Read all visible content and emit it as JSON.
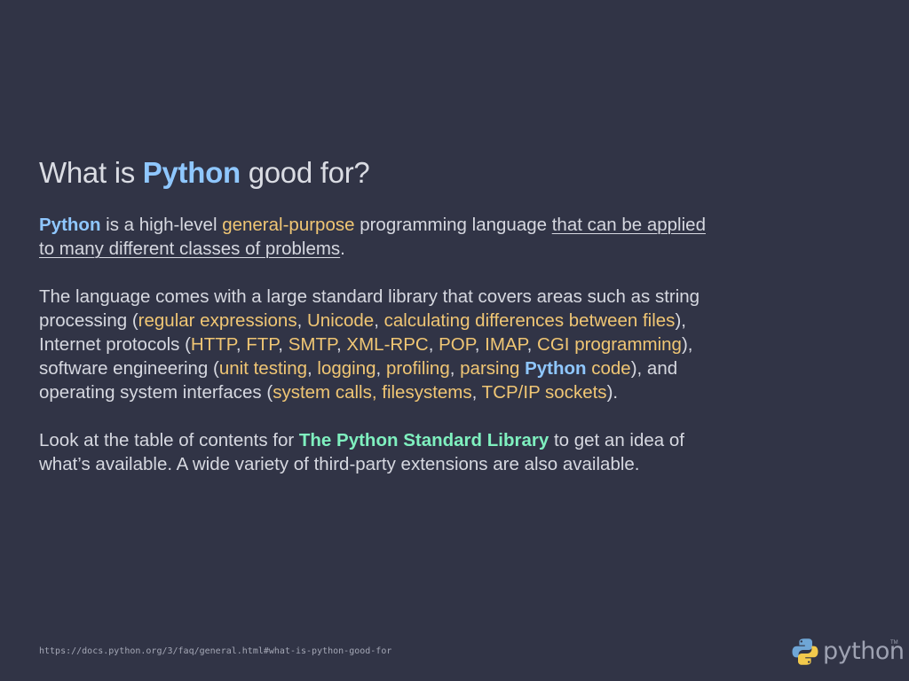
{
  "title": {
    "before": "What is ",
    "emph": "Python",
    "after": " good for?"
  },
  "p1": {
    "python": "Python",
    "t1": " is a high-level ",
    "gp": "general-purpose",
    "t2": " programming language ",
    "u1": "that can be applied",
    "u2": "to many different classes of problems",
    "t3": "."
  },
  "p2": {
    "l1": "The language comes with a large standard library that covers areas such as string",
    "l2a": "processing (",
    "regex": "regular expressions",
    "l2b": ", ",
    "unicode": "Unicode",
    "l2c": ", ",
    "diff": "calculating differences between files",
    "l2d": "),",
    "l3a": "Internet protocols (",
    "http": "HTTP",
    "l3b": ", ",
    "ftp": "FTP",
    "l3c": ", ",
    "smtp": "SMTP",
    "l3d": ", ",
    "xmlrpc": "XML-RPC",
    "l3e": ", ",
    "pop": "POP",
    "l3f": ", ",
    "imap": "IMAP",
    "l3g": ", ",
    "cgi": "CGI programming",
    "l3h": "),",
    "l4a": "software engineering (",
    "unittest": "unit testing",
    "l4b": ", ",
    "logging": "logging",
    "l4c": ", ",
    "profiling": "profiling",
    "l4d": ", ",
    "parsing": "parsing",
    "l4e": " ",
    "python": "Python",
    "code": " code",
    "l4f": "), and",
    "l5a": "operating system interfaces (",
    "syscalls": "system calls",
    "l5b": ", ",
    "fs": "filesystems",
    "l5c": ", ",
    "tcp": "TCP/IP sockets",
    "l5d": ")."
  },
  "p3": {
    "t1": "Look at the table of contents for ",
    "lib": "The Python Standard Library",
    "t2": " to get an idea of",
    "l2": "what’s available. A wide variety of third-party extensions are also available."
  },
  "footer": {
    "url": "https://docs.python.org/3/faq/general.html#what-is-python-good-for"
  },
  "logo": {
    "word": "python",
    "tm": "TM",
    "icon": "python-logo-icon"
  },
  "colors": {
    "background": "#313446",
    "text": "#d6d8e0",
    "python_accent": "#8fc7ff",
    "highlight": "#f0c674",
    "library_accent": "#7ff0bf"
  }
}
